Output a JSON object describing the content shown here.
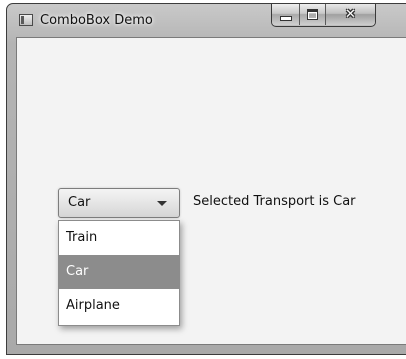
{
  "window": {
    "title": "ComboBox Demo"
  },
  "combo": {
    "value": "Car",
    "options": [
      "Train",
      "Car",
      "Airplane"
    ],
    "selected_index": 1
  },
  "status": {
    "text": "Selected Transport is Car"
  }
}
